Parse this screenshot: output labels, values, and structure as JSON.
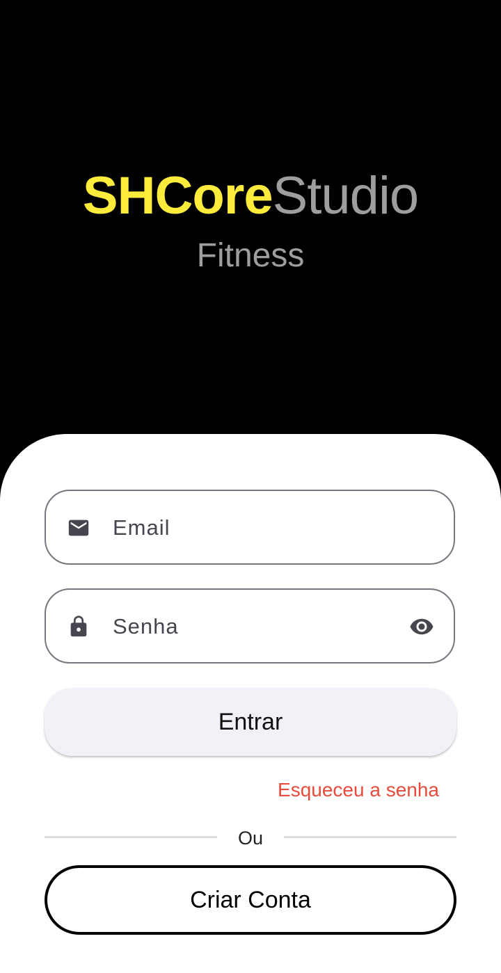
{
  "header": {
    "brand_strong": "SHCore",
    "brand_light": "Studio",
    "subtitle": "Fitness"
  },
  "form": {
    "email": {
      "placeholder": "Email",
      "icon": "email-icon"
    },
    "password": {
      "placeholder": "Senha",
      "icon": "lock-icon",
      "toggle_icon": "eye-icon"
    },
    "login_label": "Entrar",
    "forgot_label": "Esqueceu a senha",
    "divider_label": "Ou",
    "create_account_label": "Criar Conta"
  },
  "colors": {
    "brand_accent": "#ffeb3b",
    "brand_muted": "#9e9e9e",
    "link_red": "#e84a3b",
    "button_tint": "#f4f0f7",
    "outline": "#79747e"
  }
}
